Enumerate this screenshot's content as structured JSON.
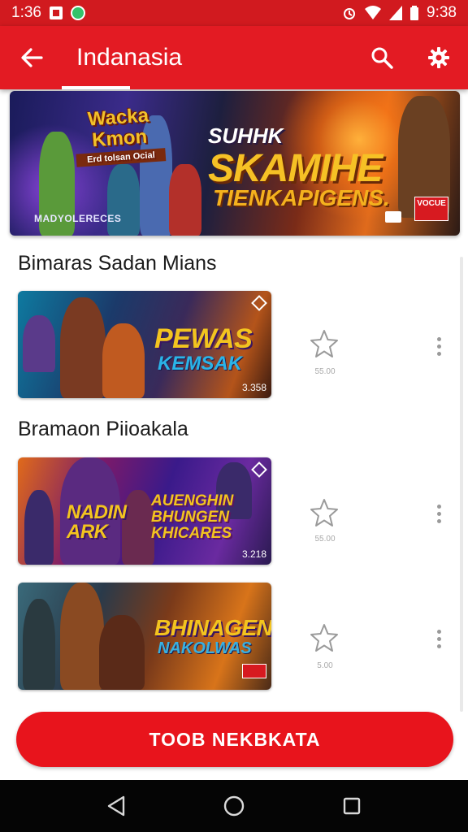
{
  "status_bar": {
    "time_left": "1:36",
    "time_right": "9:38"
  },
  "app_bar": {
    "title": "Indanasia",
    "back_icon": "arrow-left-icon",
    "search_icon": "search-icon",
    "settings_icon": "gear-icon"
  },
  "hero": {
    "logo_title": "Wacka Kmon",
    "logo_sub": "Erd tolsan Ocial",
    "line1": "SUHHK",
    "line2": "SKAMIHE",
    "line3": "TIENKAPIGENS.",
    "caption": "MADYOLERECES",
    "badge": "VOCUE"
  },
  "sections": [
    {
      "title": "Bimaras Sadan Mians"
    },
    {
      "title": "Bramaon Piioakala"
    }
  ],
  "items": [
    {
      "headline": "PEWAS",
      "subline": "KEMSAK",
      "price": "3.358",
      "rating": "55.00"
    },
    {
      "headline": "NADIN ARK",
      "subline": "AUENGHIN BHUNGEN KHICARES",
      "price": "3.218",
      "rating": "55.00"
    },
    {
      "headline": "BHINAGEN",
      "subline": "NAKOLWAS",
      "price": "",
      "rating": "5.00"
    }
  ],
  "cta": {
    "label": "TOOB NEKBKATA"
  },
  "colors": {
    "primary": "#e31b23",
    "status": "#d11a1f",
    "accent_yellow": "#f3c41f"
  }
}
